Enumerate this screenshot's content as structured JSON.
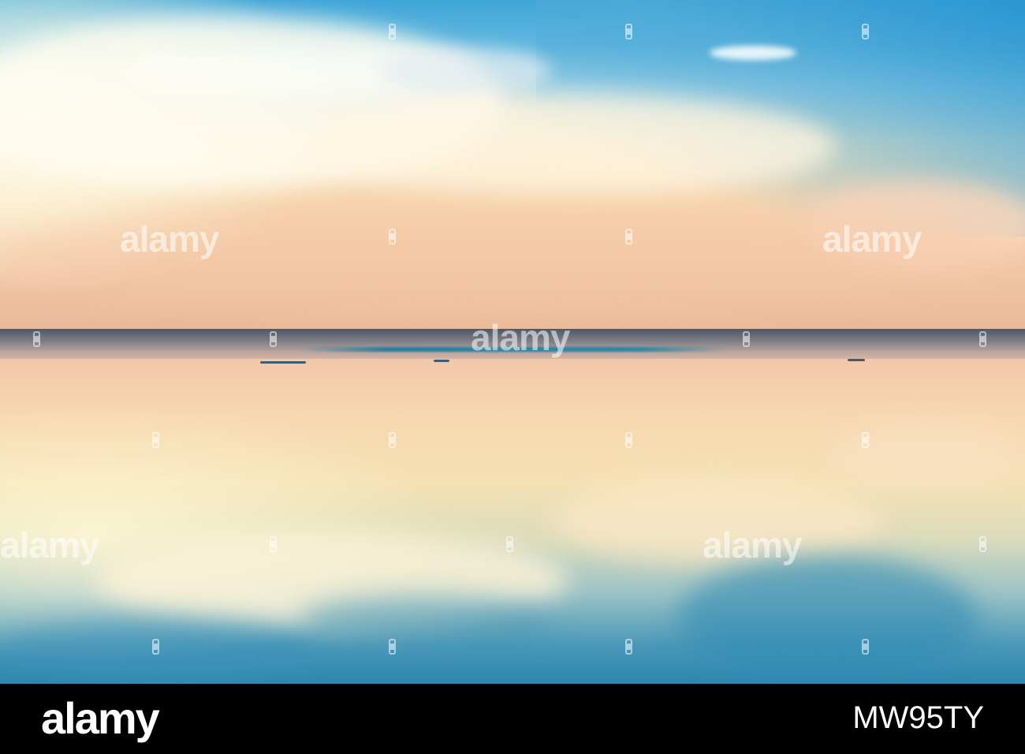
{
  "footer": {
    "logo_text": "alamy",
    "image_code": "MW95TY"
  },
  "watermarks": {
    "word": "alamy"
  },
  "colors": {
    "sky_top": "#3fa6d8",
    "sky_horizon": "#eab89a",
    "water_bottom": "#2e86b0",
    "footer_bg": "#000000"
  }
}
